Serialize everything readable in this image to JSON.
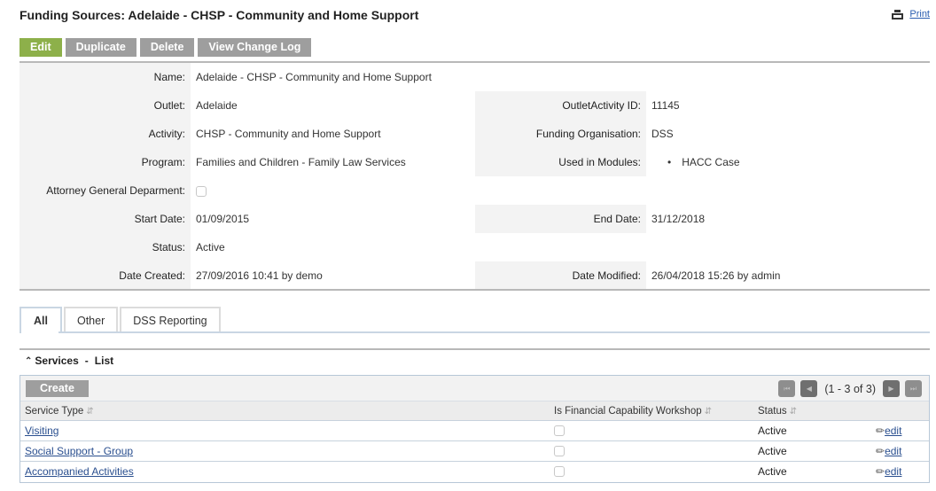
{
  "page": {
    "title": "Funding Sources: Adelaide - CHSP - Community and Home Support",
    "print_label": "Print",
    "print_icon": "printer-icon"
  },
  "toolbar": {
    "edit": "Edit",
    "duplicate": "Duplicate",
    "delete": "Delete",
    "change_log": "View Change Log"
  },
  "details": {
    "name": {
      "label": "Name:",
      "value": "Adelaide - CHSP - Community and Home Support"
    },
    "outlet": {
      "label": "Outlet:",
      "value": "Adelaide"
    },
    "activity": {
      "label": "Activity:",
      "value": "CHSP - Community and Home Support"
    },
    "program": {
      "label": "Program:",
      "value": "Families and Children - Family Law Services"
    },
    "attorney": {
      "label": "Attorney General Deparment:",
      "checked": false
    },
    "start_date": {
      "label": "Start Date:",
      "value": "01/09/2015"
    },
    "status": {
      "label": "Status:",
      "value": "Active"
    },
    "date_created": {
      "label": "Date Created:",
      "value": "27/09/2016 10:41 by demo"
    },
    "outlet_activity_id": {
      "label": "OutletActivity ID:",
      "value": "11145"
    },
    "funding_org": {
      "label": "Funding Organisation:",
      "value": "DSS"
    },
    "modules": {
      "label": "Used in Modules:",
      "items": [
        "HACC Case"
      ]
    },
    "end_date": {
      "label": "End Date:",
      "value": "31/12/2018"
    },
    "date_modified": {
      "label": "Date Modified:",
      "value": "26/04/2018 15:26 by admin"
    }
  },
  "tabs": [
    {
      "label": "All",
      "active": true
    },
    {
      "label": "Other",
      "active": false
    },
    {
      "label": "DSS Reporting",
      "active": false
    }
  ],
  "services": {
    "title": "Services",
    "separator": "-",
    "subtitle": "List",
    "create_label": "Create",
    "pager_text": "(1 - 3 of 3)",
    "columns": [
      "Service Type",
      "Is Financial Capability Workshop",
      "Status"
    ],
    "rows": [
      {
        "service_type": "Visiting",
        "financial_workshop": false,
        "status": "Active",
        "action": "edit"
      },
      {
        "service_type": "Social Support - Group",
        "financial_workshop": false,
        "status": "Active",
        "action": "edit"
      },
      {
        "service_type": "Accompanied Activities",
        "financial_workshop": false,
        "status": "Active",
        "action": "edit"
      }
    ]
  }
}
